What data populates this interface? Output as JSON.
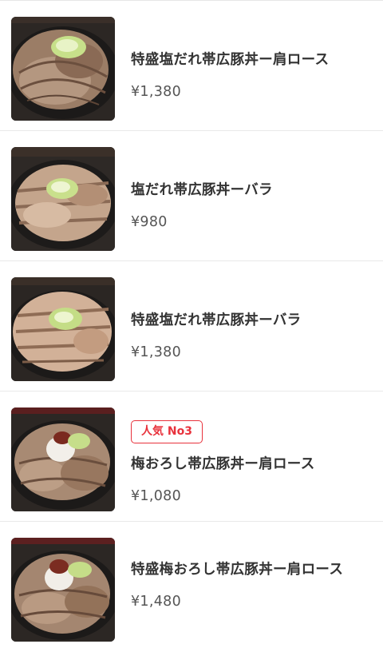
{
  "menu": {
    "items": [
      {
        "name": "特盛塩だれ帯広豚丼ー肩ロース",
        "price": "¥1,380",
        "badge": ""
      },
      {
        "name": "塩だれ帯広豚丼ーバラ",
        "price": "¥980",
        "badge": ""
      },
      {
        "name": "特盛塩だれ帯広豚丼ーバラ",
        "price": "¥1,380",
        "badge": ""
      },
      {
        "name": "梅おろし帯広豚丼ー肩ロース",
        "price": "¥1,080",
        "badge": "人気 No3"
      },
      {
        "name": "特盛梅おろし帯広豚丼ー肩ロース",
        "price": "¥1,480",
        "badge": ""
      }
    ],
    "badge_color": "#e8323c"
  }
}
